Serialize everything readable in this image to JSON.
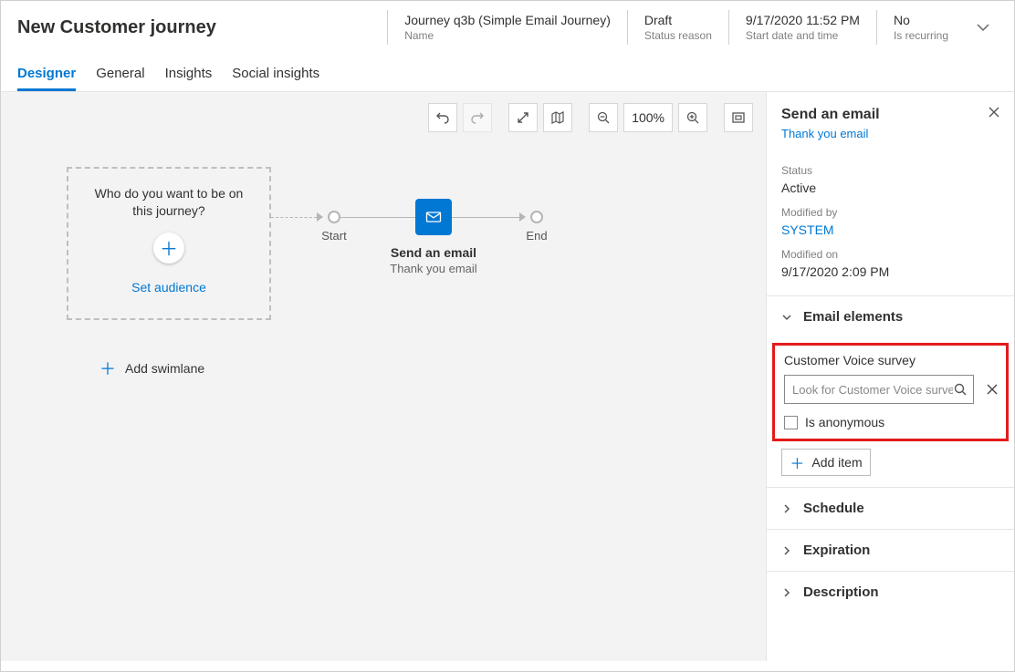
{
  "header": {
    "title": "New Customer journey",
    "fields": {
      "name": {
        "value": "Journey q3b (Simple Email Journey)",
        "label": "Name"
      },
      "status": {
        "value": "Draft",
        "label": "Status reason"
      },
      "start": {
        "value": "9/17/2020 11:52 PM",
        "label": "Start date and time"
      },
      "recurring": {
        "value": "No",
        "label": "Is recurring"
      }
    }
  },
  "tabs": [
    "Designer",
    "General",
    "Insights",
    "Social insights"
  ],
  "toolbar": {
    "zoom": "100%"
  },
  "canvas": {
    "audience_q": "Who do you want to be on this journey?",
    "set_audience": "Set audience",
    "start_label": "Start",
    "end_label": "End",
    "email_title": "Send an email",
    "email_sub": "Thank you email",
    "add_swimlane": "Add swimlane"
  },
  "panel": {
    "title": "Send an email",
    "subtitle": "Thank you email",
    "status_label": "Status",
    "status_value": "Active",
    "modifiedby_label": "Modified by",
    "modifiedby_value": "SYSTEM",
    "modifiedon_label": "Modified on",
    "modifiedon_value": "9/17/2020 2:09 PM",
    "email_elements": "Email elements",
    "survey_label": "Customer Voice survey",
    "survey_placeholder": "Look for Customer Voice survey",
    "is_anonymous": "Is anonymous",
    "add_item": "Add item",
    "schedule": "Schedule",
    "expiration": "Expiration",
    "description": "Description"
  }
}
